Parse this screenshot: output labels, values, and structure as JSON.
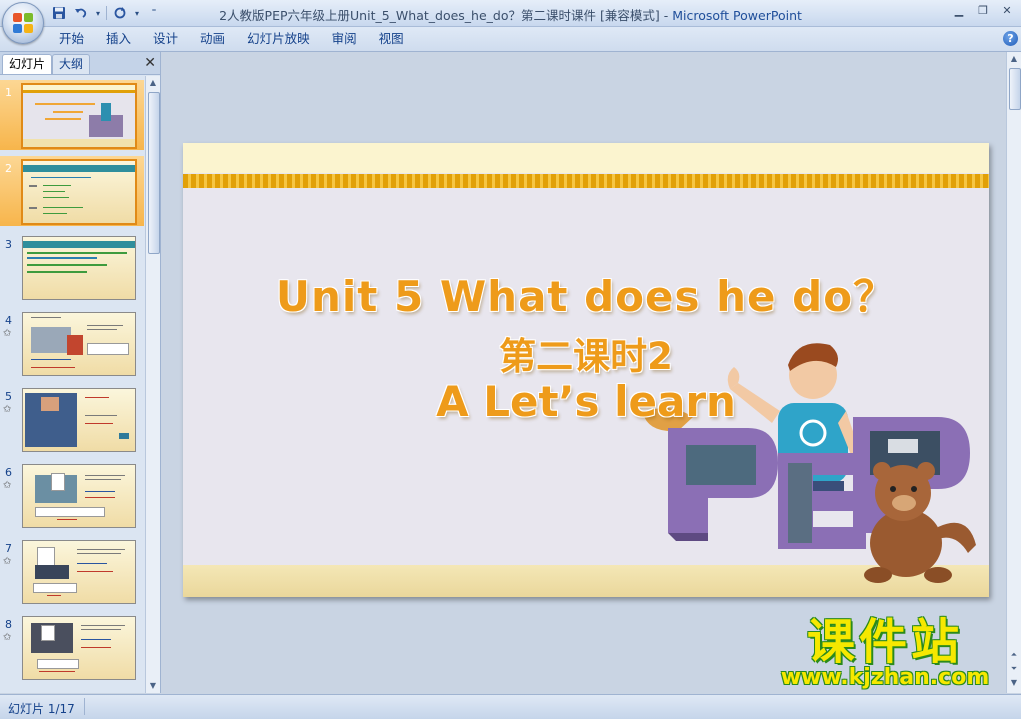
{
  "window": {
    "title_main": "2人教版PEP六年级上册Unit_5_What_does_he_do？第二课时课件 [兼容模式]",
    "title_sep": " - ",
    "app_name": "Microsoft PowerPoint"
  },
  "qat": {
    "save_icon": "save-icon",
    "undo_icon": "undo-icon",
    "redo_icon": "redo-icon",
    "customize_icon": "chevron-down-icon"
  },
  "ribbon": {
    "tabs": [
      "开始",
      "插入",
      "设计",
      "动画",
      "幻灯片放映",
      "审阅",
      "视图"
    ]
  },
  "pane": {
    "tab_slides": "幻灯片",
    "tab_outline": "大纲",
    "close": "✕",
    "thumbnails": [
      {
        "num": "1"
      },
      {
        "num": "2"
      },
      {
        "num": "3"
      },
      {
        "num": "4"
      },
      {
        "num": "5"
      },
      {
        "num": "6"
      },
      {
        "num": "7"
      },
      {
        "num": "8"
      }
    ]
  },
  "slide": {
    "title_en": "Unit 5 What does he do？",
    "title_cn": "第二课时2",
    "subtitle": "A Let’s learn",
    "logo_text": "PEP"
  },
  "watermark": {
    "cn": "课件站",
    "url": "www.kjzhan.com"
  },
  "status": {
    "slide_info": "幻灯片 1/17"
  },
  "colors": {
    "title_orange": "#ee9b1a",
    "selected_thumb": "#f7b54b",
    "ribbon_text": "#15428b",
    "watermark_yellow": "#f6e800"
  }
}
